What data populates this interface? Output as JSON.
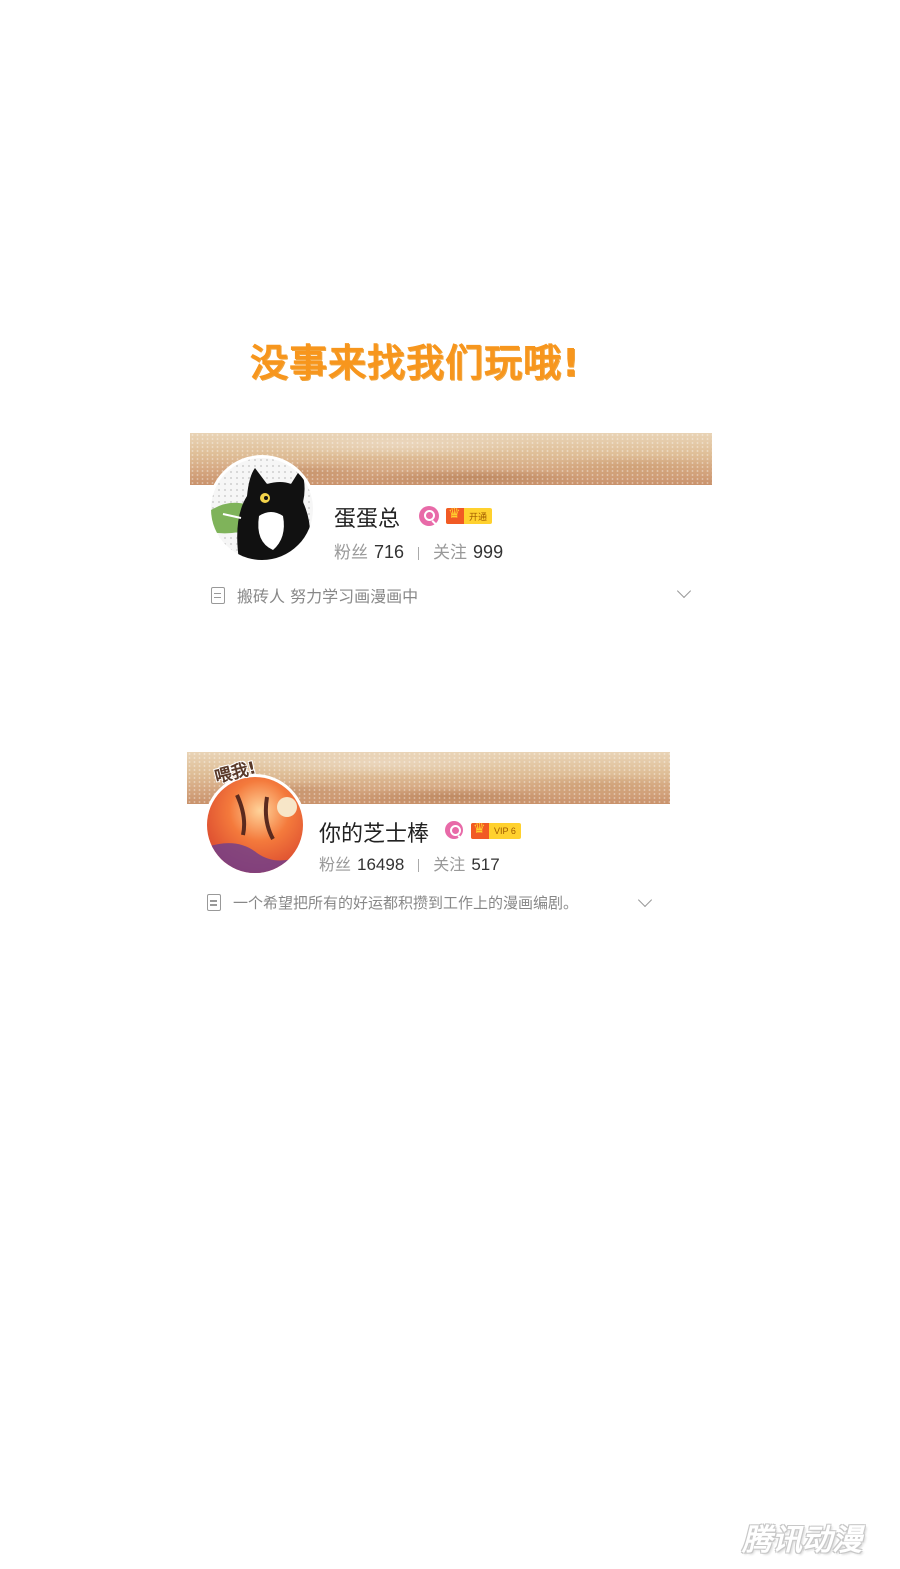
{
  "headline": "没事来找我们玩哦!",
  "profiles": [
    {
      "name": "蛋蛋总",
      "vip_label": "开通",
      "fans_label": "粉丝",
      "fans_count": "716",
      "follow_label": "关注",
      "follow_count": "999",
      "bio": "搬砖人 努力学习画漫画中"
    },
    {
      "name": "你的芝士棒",
      "vip_label": "VIP 6",
      "fans_label": "粉丝",
      "fans_count": "16498",
      "follow_label": "关注",
      "follow_count": "517",
      "bio": "一个希望把所有的好运都积攒到工作上的漫画编剧。",
      "avatar_sticker": "喂我!"
    }
  ],
  "watermark": "腾讯动漫",
  "colors": {
    "headline": "#f7961d",
    "verify_badge": "#e86aa8",
    "vip_badge": "#ffd12e"
  },
  "icons": [
    "verified-icon",
    "vip-crown-icon",
    "document-icon",
    "chevron-down-icon"
  ]
}
